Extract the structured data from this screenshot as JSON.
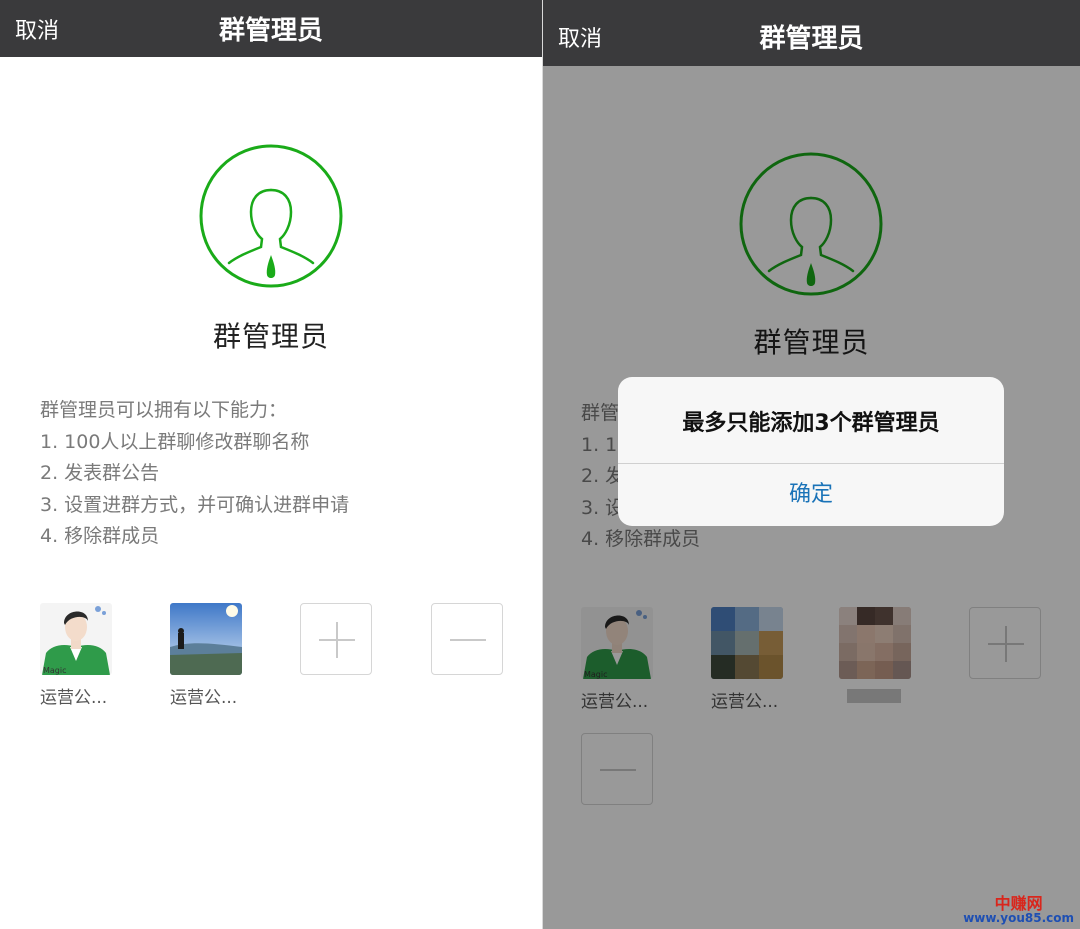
{
  "left": {
    "nav": {
      "cancel": "取消",
      "title": "群管理员"
    },
    "hero_title": "群管理员",
    "capabilities": [
      "群管理员可以拥有以下能力：",
      "1. 100人以上群聊修改群聊名称",
      "2. 发表群公告",
      "3. 设置进群方式，并可确认进群申请",
      "4. 移除群成员"
    ],
    "members": [
      {
        "name": "运营公...",
        "avatar": "anime-man-green-jacket"
      },
      {
        "name": "运营公...",
        "avatar": "landscape-silhouette"
      }
    ],
    "add_icon": "plus-icon",
    "remove_icon": "minus-icon"
  },
  "right": {
    "nav": {
      "cancel": "取消",
      "title": "群管理员"
    },
    "hero_title": "群管理员",
    "capabilities": [
      "群管",
      "1. 10",
      "2. 发",
      "3. 设",
      "4. 移除群成员"
    ],
    "members": [
      {
        "name": "运营公...",
        "avatar": "anime-man-green-jacket"
      },
      {
        "name": "运营公...",
        "avatar": "landscape-pixelated"
      },
      {
        "name": "",
        "avatar": "portrait-pixelated"
      }
    ],
    "alert": {
      "message": "最多只能添加3个群管理员",
      "button": "确定"
    }
  },
  "watermark": {
    "brand": "中赚网",
    "url": "www.you85.com"
  },
  "colors": {
    "accent_green": "#1aab19",
    "navbar": "#3a3a3c",
    "alert_button": "#1a73b8",
    "overlay": "rgba(0,0,0,0.40)"
  }
}
